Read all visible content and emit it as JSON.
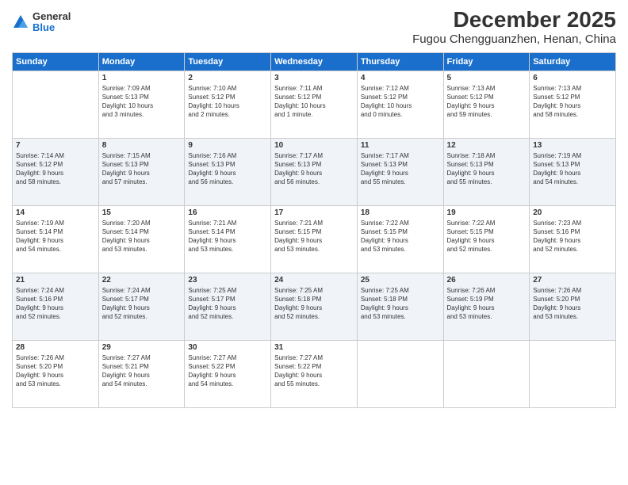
{
  "header": {
    "logo": {
      "general": "General",
      "blue": "Blue"
    },
    "title": "December 2025",
    "subtitle": "Fugou Chengguanzhen, Henan, China"
  },
  "days_of_week": [
    "Sunday",
    "Monday",
    "Tuesday",
    "Wednesday",
    "Thursday",
    "Friday",
    "Saturday"
  ],
  "weeks": [
    [
      {
        "day": "",
        "info": ""
      },
      {
        "day": "1",
        "info": "Sunrise: 7:09 AM\nSunset: 5:13 PM\nDaylight: 10 hours\nand 3 minutes."
      },
      {
        "day": "2",
        "info": "Sunrise: 7:10 AM\nSunset: 5:12 PM\nDaylight: 10 hours\nand 2 minutes."
      },
      {
        "day": "3",
        "info": "Sunrise: 7:11 AM\nSunset: 5:12 PM\nDaylight: 10 hours\nand 1 minute."
      },
      {
        "day": "4",
        "info": "Sunrise: 7:12 AM\nSunset: 5:12 PM\nDaylight: 10 hours\nand 0 minutes."
      },
      {
        "day": "5",
        "info": "Sunrise: 7:13 AM\nSunset: 5:12 PM\nDaylight: 9 hours\nand 59 minutes."
      },
      {
        "day": "6",
        "info": "Sunrise: 7:13 AM\nSunset: 5:12 PM\nDaylight: 9 hours\nand 58 minutes."
      }
    ],
    [
      {
        "day": "7",
        "info": "Sunrise: 7:14 AM\nSunset: 5:12 PM\nDaylight: 9 hours\nand 58 minutes."
      },
      {
        "day": "8",
        "info": "Sunrise: 7:15 AM\nSunset: 5:13 PM\nDaylight: 9 hours\nand 57 minutes."
      },
      {
        "day": "9",
        "info": "Sunrise: 7:16 AM\nSunset: 5:13 PM\nDaylight: 9 hours\nand 56 minutes."
      },
      {
        "day": "10",
        "info": "Sunrise: 7:17 AM\nSunset: 5:13 PM\nDaylight: 9 hours\nand 56 minutes."
      },
      {
        "day": "11",
        "info": "Sunrise: 7:17 AM\nSunset: 5:13 PM\nDaylight: 9 hours\nand 55 minutes."
      },
      {
        "day": "12",
        "info": "Sunrise: 7:18 AM\nSunset: 5:13 PM\nDaylight: 9 hours\nand 55 minutes."
      },
      {
        "day": "13",
        "info": "Sunrise: 7:19 AM\nSunset: 5:13 PM\nDaylight: 9 hours\nand 54 minutes."
      }
    ],
    [
      {
        "day": "14",
        "info": "Sunrise: 7:19 AM\nSunset: 5:14 PM\nDaylight: 9 hours\nand 54 minutes."
      },
      {
        "day": "15",
        "info": "Sunrise: 7:20 AM\nSunset: 5:14 PM\nDaylight: 9 hours\nand 53 minutes."
      },
      {
        "day": "16",
        "info": "Sunrise: 7:21 AM\nSunset: 5:14 PM\nDaylight: 9 hours\nand 53 minutes."
      },
      {
        "day": "17",
        "info": "Sunrise: 7:21 AM\nSunset: 5:15 PM\nDaylight: 9 hours\nand 53 minutes."
      },
      {
        "day": "18",
        "info": "Sunrise: 7:22 AM\nSunset: 5:15 PM\nDaylight: 9 hours\nand 53 minutes."
      },
      {
        "day": "19",
        "info": "Sunrise: 7:22 AM\nSunset: 5:15 PM\nDaylight: 9 hours\nand 52 minutes."
      },
      {
        "day": "20",
        "info": "Sunrise: 7:23 AM\nSunset: 5:16 PM\nDaylight: 9 hours\nand 52 minutes."
      }
    ],
    [
      {
        "day": "21",
        "info": "Sunrise: 7:24 AM\nSunset: 5:16 PM\nDaylight: 9 hours\nand 52 minutes."
      },
      {
        "day": "22",
        "info": "Sunrise: 7:24 AM\nSunset: 5:17 PM\nDaylight: 9 hours\nand 52 minutes."
      },
      {
        "day": "23",
        "info": "Sunrise: 7:25 AM\nSunset: 5:17 PM\nDaylight: 9 hours\nand 52 minutes."
      },
      {
        "day": "24",
        "info": "Sunrise: 7:25 AM\nSunset: 5:18 PM\nDaylight: 9 hours\nand 52 minutes."
      },
      {
        "day": "25",
        "info": "Sunrise: 7:25 AM\nSunset: 5:18 PM\nDaylight: 9 hours\nand 53 minutes."
      },
      {
        "day": "26",
        "info": "Sunrise: 7:26 AM\nSunset: 5:19 PM\nDaylight: 9 hours\nand 53 minutes."
      },
      {
        "day": "27",
        "info": "Sunrise: 7:26 AM\nSunset: 5:20 PM\nDaylight: 9 hours\nand 53 minutes."
      }
    ],
    [
      {
        "day": "28",
        "info": "Sunrise: 7:26 AM\nSunset: 5:20 PM\nDaylight: 9 hours\nand 53 minutes."
      },
      {
        "day": "29",
        "info": "Sunrise: 7:27 AM\nSunset: 5:21 PM\nDaylight: 9 hours\nand 54 minutes."
      },
      {
        "day": "30",
        "info": "Sunrise: 7:27 AM\nSunset: 5:22 PM\nDaylight: 9 hours\nand 54 minutes."
      },
      {
        "day": "31",
        "info": "Sunrise: 7:27 AM\nSunset: 5:22 PM\nDaylight: 9 hours\nand 55 minutes."
      },
      {
        "day": "",
        "info": ""
      },
      {
        "day": "",
        "info": ""
      },
      {
        "day": "",
        "info": ""
      }
    ]
  ]
}
